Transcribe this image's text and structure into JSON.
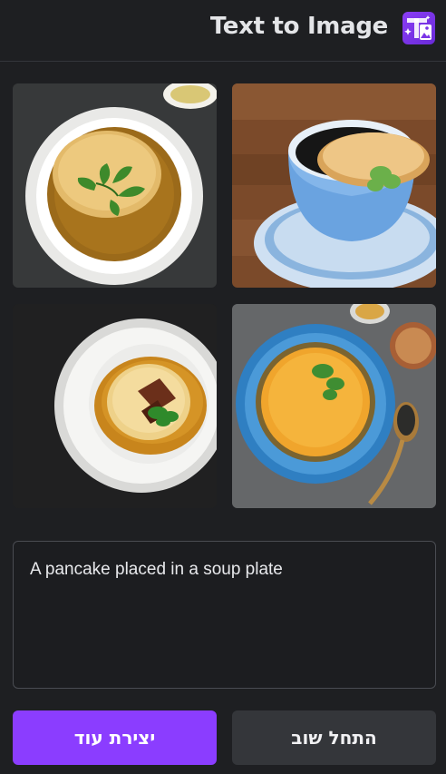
{
  "header": {
    "title": "Text to Image",
    "icon": "text-to-image-app-icon"
  },
  "results": {
    "images": [
      {
        "label": "pancake-in-soup-result-1"
      },
      {
        "label": "pancake-in-soup-result-2"
      },
      {
        "label": "pancake-in-soup-result-3"
      },
      {
        "label": "pancake-in-soup-result-4"
      }
    ]
  },
  "prompt": {
    "value": "A pancake placed in a soup plate"
  },
  "actions": {
    "create_more_label": "יצירת עוד",
    "start_over_label": "התחל שוב"
  },
  "colors": {
    "background": "#1e1f22",
    "accent": "#8b3dff",
    "secondary_button": "#34363a"
  }
}
